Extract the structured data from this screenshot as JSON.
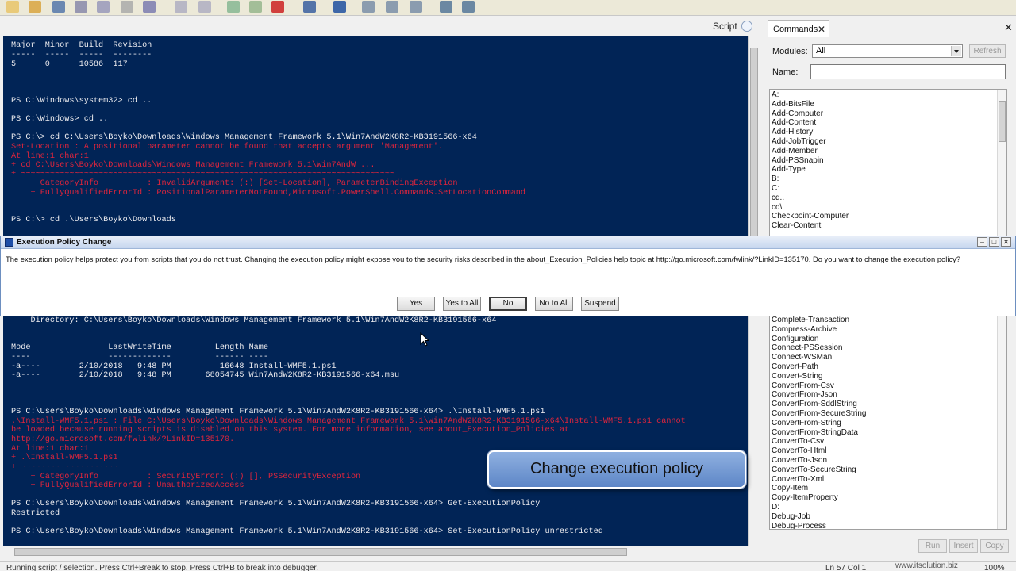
{
  "toolbar": {
    "icons": [
      "new-icon",
      "open-icon",
      "save-icon",
      "cut-icon",
      "copy-icon",
      "paste-icon",
      "clear-icon",
      "undo-icon",
      "redo-icon",
      "run-icon",
      "run-selection-icon",
      "stop-icon",
      "remote-icon",
      "powershell-icon",
      "layout-top-icon",
      "layout-right-icon",
      "layout-maximize-icon",
      "show-script-icon",
      "show-commands-icon"
    ]
  },
  "script_bar": {
    "label": "Script"
  },
  "console": {
    "lines": [
      {
        "text": "Major  Minor  Build  Revision",
        "type": "out"
      },
      {
        "text": "-----  -----  -----  --------",
        "type": "out"
      },
      {
        "text": "5      0      10586  117",
        "type": "out"
      },
      {
        "text": "PS C:\\Windows\\system32> cd ..",
        "type": "out"
      },
      {
        "text": "PS C:\\Windows> cd ..",
        "type": "out"
      },
      {
        "text": "PS C:\\> cd C:\\Users\\Boyko\\Downloads\\Windows Management Framework 5.1\\Win7AndW2K8R2-KB3191566-x64",
        "type": "out"
      },
      {
        "text": "Set-Location : A positional parameter cannot be found that accepts argument 'Management'.",
        "type": "err"
      },
      {
        "text": "At line:1 char:1",
        "type": "err"
      },
      {
        "text": "+ cd C:\\Users\\Boyko\\Downloads\\Windows Management Framework 5.1\\Win7AndW ...",
        "type": "err"
      },
      {
        "text": "+ ~~~~~~~~~~~~~~~~~~~~~~~~~~~~~~~~~~~~~~~~~~~~~~~~~~~~~~~~~~~~~~~~~~~~~~~~~~~~~",
        "type": "err"
      },
      {
        "text": "    + CategoryInfo          : InvalidArgument: (:) [Set-Location], ParameterBindingException",
        "type": "err"
      },
      {
        "text": "    + FullyQualifiedErrorId : PositionalParameterNotFound,Microsoft.PowerShell.Commands.SetLocationCommand",
        "type": "err"
      },
      {
        "text": "PS C:\\> cd .\\Users\\Boyko\\Downloads",
        "type": "out"
      },
      {
        "text": "    Directory: C:\\Users\\Boyko\\Downloads\\Windows Management Framework 5.1\\Win7AndW2K8R2-KB3191566-x64",
        "type": "out"
      },
      {
        "text": "Mode                LastWriteTime         Length Name",
        "type": "out"
      },
      {
        "text": "----                -------------         ------ ----",
        "type": "out"
      },
      {
        "text": "-a----        2/10/2018   9:48 PM          16648 Install-WMF5.1.ps1",
        "type": "out"
      },
      {
        "text": "-a----        2/10/2018   9:48 PM       68054745 Win7AndW2K8R2-KB3191566-x64.msu",
        "type": "out"
      },
      {
        "text": "PS C:\\Users\\Boyko\\Downloads\\Windows Management Framework 5.1\\Win7AndW2K8R2-KB3191566-x64> .\\Install-WMF5.1.ps1",
        "type": "out"
      },
      {
        "text": ".\\Install-WMF5.1.ps1 : File C:\\Users\\Boyko\\Downloads\\Windows Management Framework 5.1\\Win7AndW2K8R2-KB3191566-x64\\Install-WMF5.1.ps1 cannot",
        "type": "err"
      },
      {
        "text": "be loaded because running scripts is disabled on this system. For more information, see about_Execution_Policies at",
        "type": "err"
      },
      {
        "text": "http://go.microsoft.com/fwlink/?LinkID=135170.",
        "type": "err"
      },
      {
        "text": "At line:1 char:1",
        "type": "err"
      },
      {
        "text": "+ .\\Install-WMF5.1.ps1",
        "type": "err"
      },
      {
        "text": "+ ~~~~~~~~~~~~~~~~~~~~",
        "type": "err"
      },
      {
        "text": "    + CategoryInfo          : SecurityError: (:) [], PSSecurityException",
        "type": "err"
      },
      {
        "text": "    + FullyQualifiedErrorId : UnauthorizedAccess",
        "type": "err"
      },
      {
        "text": "PS C:\\Users\\Boyko\\Downloads\\Windows Management Framework 5.1\\Win7AndW2K8R2-KB3191566-x64> Get-ExecutionPolicy",
        "type": "out"
      },
      {
        "text": "Restricted",
        "type": "out"
      },
      {
        "text": "PS C:\\Users\\Boyko\\Downloads\\Windows Management Framework 5.1\\Win7AndW2K8R2-KB3191566-x64> Set-ExecutionPolicy unrestricted",
        "type": "out"
      }
    ]
  },
  "dialog": {
    "title": "Execution Policy Change",
    "message": "The execution policy helps protect you from scripts that you do not trust. Changing the execution policy might expose you to the security risks described in the about_Execution_Policies help topic at http://go.microsoft.com/fwlink/?LinkID=135170. Do you want to change the execution policy?",
    "buttons": [
      "Yes",
      "Yes to All",
      "No",
      "No to All",
      "Suspend"
    ],
    "default_button": "No"
  },
  "callout": {
    "text": "Change execution policy"
  },
  "commands": {
    "tab_label": "Commands",
    "modules_label": "Modules:",
    "modules_value": "All",
    "refresh_label": "Refresh",
    "name_label": "Name:",
    "name_value": "",
    "items_top": [
      "A:",
      "Add-BitsFile",
      "Add-Computer",
      "Add-Content",
      "Add-History",
      "Add-JobTrigger",
      "Add-Member",
      "Add-PSSnapin",
      "Add-Type",
      "B:",
      "C:",
      "cd..",
      "cd\\",
      "Checkpoint-Computer",
      "Clear-Content"
    ],
    "items_bottom": [
      "Complete-Transaction",
      "Compress-Archive",
      "Configuration",
      "Connect-PSSession",
      "Connect-WSMan",
      "Convert-Path",
      "Convert-String",
      "ConvertFrom-Csv",
      "ConvertFrom-Json",
      "ConvertFrom-SddlString",
      "ConvertFrom-SecureString",
      "ConvertFrom-String",
      "ConvertFrom-StringData",
      "ConvertTo-Csv",
      "ConvertTo-Html",
      "ConvertTo-Json",
      "ConvertTo-SecureString",
      "ConvertTo-Xml",
      "Copy-Item",
      "Copy-ItemProperty",
      "D:",
      "Debug-Job",
      "Debug-Process"
    ],
    "buttons": [
      "Run",
      "Insert",
      "Copy"
    ]
  },
  "status": {
    "message": "Running script / selection.  Press Ctrl+Break to stop.  Press Ctrl+B to break into debugger.",
    "position": "Ln 57  Col 1",
    "zoom": "100%"
  },
  "watermark": "www.itsolution.biz",
  "colors": {
    "console_bg": "#012456",
    "console_text": "#eeedf0",
    "console_error": "#e0243c",
    "callout_fill": "#6f96d2"
  }
}
